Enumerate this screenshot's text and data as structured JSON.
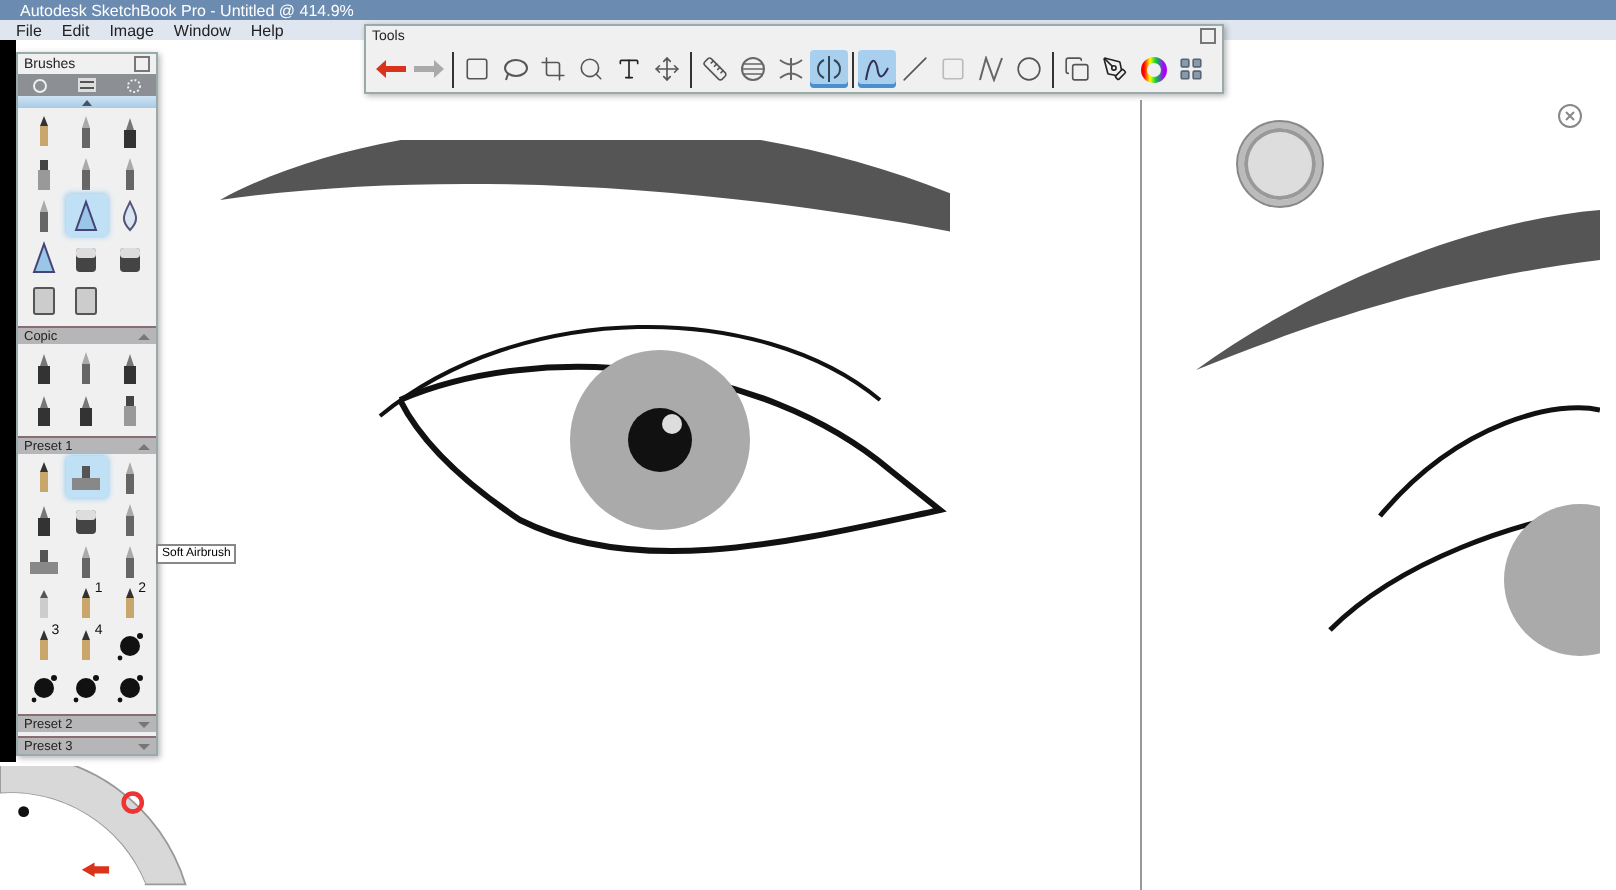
{
  "window": {
    "title": "Autodesk SketchBook Pro - Untitled @ 414.9%"
  },
  "menu": [
    "File",
    "Edit",
    "Image",
    "Window",
    "Help"
  ],
  "brushes_panel": {
    "title": "Brushes",
    "tooltip": "Soft Airbrush",
    "sections": [
      {
        "brushes": [
          {
            "kind": "pencil",
            "selected": false
          },
          {
            "kind": "pen",
            "selected": false
          },
          {
            "kind": "marker",
            "selected": false
          },
          {
            "kind": "flat",
            "selected": false
          },
          {
            "kind": "pen",
            "selected": false
          },
          {
            "kind": "pen",
            "selected": false
          },
          {
            "kind": "pen",
            "selected": false
          },
          {
            "kind": "triangle",
            "selected": true
          },
          {
            "kind": "drop",
            "selected": false
          },
          {
            "kind": "triangle",
            "selected": false
          },
          {
            "kind": "eraser",
            "selected": false
          },
          {
            "kind": "eraser",
            "selected": false
          },
          {
            "kind": "bucket",
            "selected": false
          },
          {
            "kind": "bucket",
            "selected": false
          }
        ]
      },
      {
        "title": "Copic",
        "expanded": true,
        "brushes": [
          {
            "kind": "marker",
            "selected": false
          },
          {
            "kind": "pen",
            "selected": false
          },
          {
            "kind": "marker",
            "selected": false
          },
          {
            "kind": "marker",
            "selected": false
          },
          {
            "kind": "marker",
            "selected": false
          },
          {
            "kind": "flat",
            "selected": false
          }
        ]
      },
      {
        "title": "Preset 1",
        "expanded": true,
        "brushes": [
          {
            "kind": "pencil",
            "selected": false
          },
          {
            "kind": "airbrush",
            "selected": true
          },
          {
            "kind": "pen",
            "selected": false
          },
          {
            "kind": "marker",
            "selected": false
          },
          {
            "kind": "eraser",
            "selected": false
          },
          {
            "kind": "pen",
            "selected": false
          },
          {
            "kind": "airbrush",
            "selected": false
          },
          {
            "kind": "pen",
            "selected": false
          },
          {
            "kind": "pen",
            "selected": false
          },
          {
            "kind": "smudge",
            "selected": false
          },
          {
            "kind": "pencil",
            "selected": false,
            "badge": "1"
          },
          {
            "kind": "pencil",
            "selected": false,
            "badge": "2"
          },
          {
            "kind": "pencil",
            "selected": false,
            "badge": "3"
          },
          {
            "kind": "pencil",
            "selected": false,
            "badge": "4"
          },
          {
            "kind": "splat",
            "selected": false
          },
          {
            "kind": "splat",
            "selected": false
          },
          {
            "kind": "splat",
            "selected": false
          },
          {
            "kind": "splat",
            "selected": false
          }
        ]
      },
      {
        "title": "Preset 2",
        "expanded": false
      },
      {
        "title": "Preset 3",
        "expanded": false
      }
    ]
  },
  "tools_panel": {
    "title": "Tools",
    "groups": [
      [
        {
          "kind": "undo",
          "selected": false
        },
        {
          "kind": "redo",
          "selected": false
        }
      ],
      [
        {
          "kind": "rectangle",
          "selected": false
        },
        {
          "kind": "lasso",
          "selected": false
        },
        {
          "kind": "crop",
          "selected": false
        },
        {
          "kind": "zoom",
          "selected": false
        },
        {
          "kind": "text",
          "selected": false
        },
        {
          "kind": "move",
          "selected": false
        }
      ],
      [
        {
          "kind": "ruler",
          "selected": false
        },
        {
          "kind": "ellipse",
          "selected": false
        },
        {
          "kind": "curve-ruler",
          "selected": false
        },
        {
          "kind": "symmetry",
          "selected": true
        }
      ],
      [
        {
          "kind": "curve",
          "selected": true
        },
        {
          "kind": "line",
          "selected": false
        },
        {
          "kind": "rect-shape",
          "selected": false
        },
        {
          "kind": "polyline",
          "selected": false
        },
        {
          "kind": "oval",
          "selected": false
        }
      ],
      [
        {
          "kind": "copy",
          "selected": false
        },
        {
          "kind": "brushes",
          "selected": false
        },
        {
          "kind": "color",
          "selected": false
        },
        {
          "kind": "swatches",
          "selected": false
        }
      ]
    ]
  }
}
